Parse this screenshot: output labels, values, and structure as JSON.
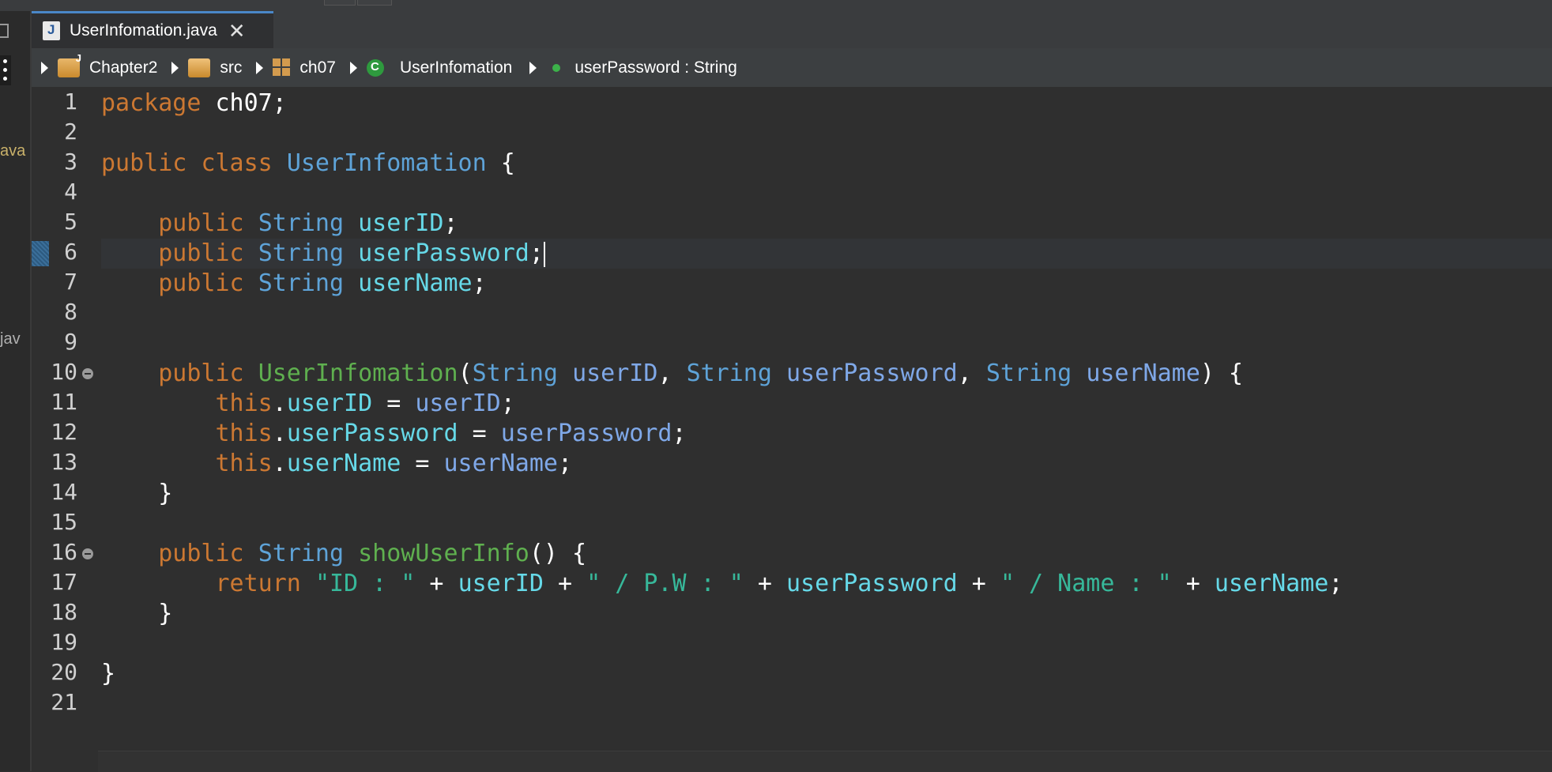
{
  "left_panel": {
    "fragments": [
      "ava",
      "jav"
    ]
  },
  "tab": {
    "icon": "java-file-icon",
    "label": "UserInfomation.java",
    "close_icon": "close-icon"
  },
  "breadcrumb": {
    "items": [
      {
        "label": "Chapter2",
        "icon": "project-folder-icon"
      },
      {
        "label": "src",
        "icon": "source-folder-icon"
      },
      {
        "label": "ch07",
        "icon": "package-icon"
      },
      {
        "label": "UserInfomation",
        "icon": "class-icon"
      },
      {
        "label": "userPassword : String",
        "icon": "field-icon"
      }
    ]
  },
  "editor": {
    "current_line": 6,
    "fold_lines": [
      10,
      16
    ],
    "line_numbers": [
      "1",
      "2",
      "3",
      "4",
      "5",
      "6",
      "7",
      "8",
      "9",
      "10",
      "11",
      "12",
      "13",
      "14",
      "15",
      "16",
      "17",
      "18",
      "19",
      "20",
      "21"
    ],
    "lines": [
      [
        [
          "kw",
          "package"
        ],
        [
          "plain",
          " ch07;"
        ]
      ],
      [],
      [
        [
          "kw",
          "public"
        ],
        [
          "plain",
          " "
        ],
        [
          "kw",
          "class"
        ],
        [
          "plain",
          " "
        ],
        [
          "cls",
          "UserInfomation"
        ],
        [
          "plain",
          " {"
        ]
      ],
      [],
      [
        [
          "plain",
          "    "
        ],
        [
          "kw",
          "public"
        ],
        [
          "plain",
          " "
        ],
        [
          "cls",
          "String"
        ],
        [
          "plain",
          " "
        ],
        [
          "field",
          "userID"
        ],
        [
          "plain",
          ";"
        ]
      ],
      [
        [
          "plain",
          "    "
        ],
        [
          "kw",
          "public"
        ],
        [
          "plain",
          " "
        ],
        [
          "cls",
          "String"
        ],
        [
          "plain",
          " "
        ],
        [
          "field",
          "userPassword"
        ],
        [
          "plain",
          ";"
        ]
      ],
      [
        [
          "plain",
          "    "
        ],
        [
          "kw",
          "public"
        ],
        [
          "plain",
          " "
        ],
        [
          "cls",
          "String"
        ],
        [
          "plain",
          " "
        ],
        [
          "field",
          "userName"
        ],
        [
          "plain",
          ";"
        ]
      ],
      [],
      [],
      [
        [
          "plain",
          "    "
        ],
        [
          "kw",
          "public"
        ],
        [
          "plain",
          " "
        ],
        [
          "method",
          "UserInfomation"
        ],
        [
          "plain",
          "("
        ],
        [
          "cls",
          "String"
        ],
        [
          "plain",
          " "
        ],
        [
          "param",
          "userID"
        ],
        [
          "plain",
          ", "
        ],
        [
          "cls",
          "String"
        ],
        [
          "plain",
          " "
        ],
        [
          "param",
          "userPassword"
        ],
        [
          "plain",
          ", "
        ],
        [
          "cls",
          "String"
        ],
        [
          "plain",
          " "
        ],
        [
          "param",
          "userName"
        ],
        [
          "plain",
          ") {"
        ]
      ],
      [
        [
          "plain",
          "        "
        ],
        [
          "kw",
          "this"
        ],
        [
          "plain",
          "."
        ],
        [
          "field",
          "userID"
        ],
        [
          "plain",
          " = "
        ],
        [
          "param",
          "userID"
        ],
        [
          "plain",
          ";"
        ]
      ],
      [
        [
          "plain",
          "        "
        ],
        [
          "kw",
          "this"
        ],
        [
          "plain",
          "."
        ],
        [
          "field",
          "userPassword"
        ],
        [
          "plain",
          " = "
        ],
        [
          "param",
          "userPassword"
        ],
        [
          "plain",
          ";"
        ]
      ],
      [
        [
          "plain",
          "        "
        ],
        [
          "kw",
          "this"
        ],
        [
          "plain",
          "."
        ],
        [
          "field",
          "userName"
        ],
        [
          "plain",
          " = "
        ],
        [
          "param",
          "userName"
        ],
        [
          "plain",
          ";"
        ]
      ],
      [
        [
          "plain",
          "    }"
        ]
      ],
      [],
      [
        [
          "plain",
          "    "
        ],
        [
          "kw",
          "public"
        ],
        [
          "plain",
          " "
        ],
        [
          "cls",
          "String"
        ],
        [
          "plain",
          " "
        ],
        [
          "method",
          "showUserInfo"
        ],
        [
          "plain",
          "() {"
        ]
      ],
      [
        [
          "plain",
          "        "
        ],
        [
          "kw",
          "return"
        ],
        [
          "plain",
          " "
        ],
        [
          "str",
          "\"ID : \""
        ],
        [
          "plain",
          " + "
        ],
        [
          "field",
          "userID"
        ],
        [
          "plain",
          " + "
        ],
        [
          "str",
          "\" / P.W : \""
        ],
        [
          "plain",
          " + "
        ],
        [
          "field",
          "userPassword"
        ],
        [
          "plain",
          " + "
        ],
        [
          "str",
          "\" / Name : \""
        ],
        [
          "plain",
          " + "
        ],
        [
          "field",
          "userName"
        ],
        [
          "plain",
          ";"
        ]
      ],
      [
        [
          "plain",
          "    }"
        ]
      ],
      [],
      [
        [
          "plain",
          "}"
        ]
      ],
      []
    ]
  },
  "colors": {
    "keyword": "#cc7832",
    "class": "#5ea3d8",
    "field": "#66d9e8",
    "param": "#7fa8e8",
    "method": "#5fb04f",
    "string": "#37b89a",
    "background": "#2f2f2f"
  }
}
